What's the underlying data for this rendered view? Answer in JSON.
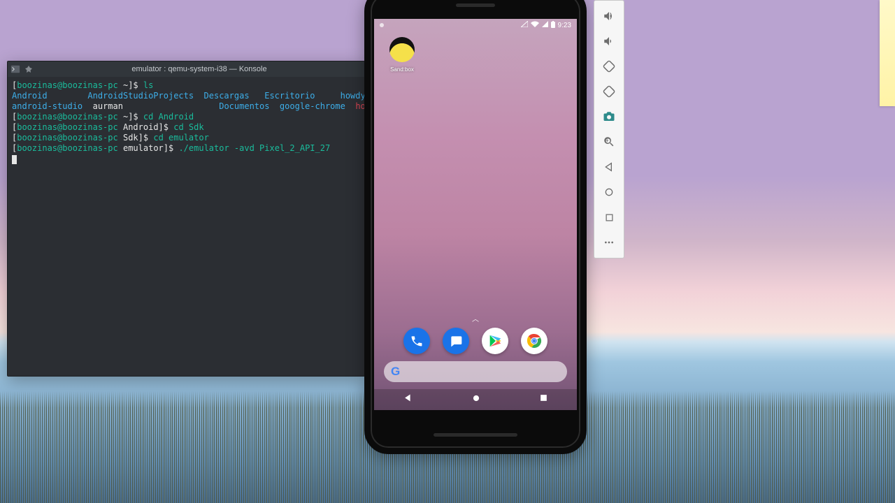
{
  "konsole": {
    "title": "emulator : qemu-system-i38 — Konsole",
    "lines": [
      {
        "prompt": {
          "user": "boozinas@boozinas-pc",
          "path": "~",
          "end": "]$"
        },
        "cmd": "ls",
        "args": ""
      },
      {
        "listing_dirs": "Android        AndroidStudioProjects  Descargas   Escritorio     ",
        "listing_dir_tail": "howdy"
      },
      {
        "listing_dir2": "android-studio  ",
        "name1": "aurman",
        "pad": "                   ",
        "listing_dirs2": "Documentos  google-chrome  ",
        "file1": "howdy.tar.gz"
      },
      {
        "prompt": {
          "user": "boozinas@boozinas-pc",
          "path": "~",
          "end": "]$"
        },
        "cmd": "cd",
        "args": " Android"
      },
      {
        "prompt": {
          "user": "boozinas@boozinas-pc",
          "path": "Android",
          "end": "]$"
        },
        "cmd": "cd",
        "args": " Sdk"
      },
      {
        "prompt": {
          "user": "boozinas@boozinas-pc",
          "path": "Sdk",
          "end": "]$"
        },
        "cmd": "cd",
        "args": " emulator"
      },
      {
        "prompt": {
          "user": "boozinas@boozinas-pc",
          "path": "emulator",
          "end": "]$"
        },
        "cmd": "./emulator",
        "args": " -avd Pixel_2_API_27"
      }
    ]
  },
  "emulator": {
    "status_time": "9:23",
    "home_app_label": "Sand:box",
    "dock_apps": [
      "phone",
      "messages",
      "play-store",
      "chrome"
    ],
    "search_placeholder": ""
  },
  "sidebar_buttons": [
    "volume-up",
    "volume-down",
    "rotate-left",
    "rotate-right",
    "screenshot",
    "zoom",
    "back",
    "home",
    "overview",
    "more"
  ]
}
